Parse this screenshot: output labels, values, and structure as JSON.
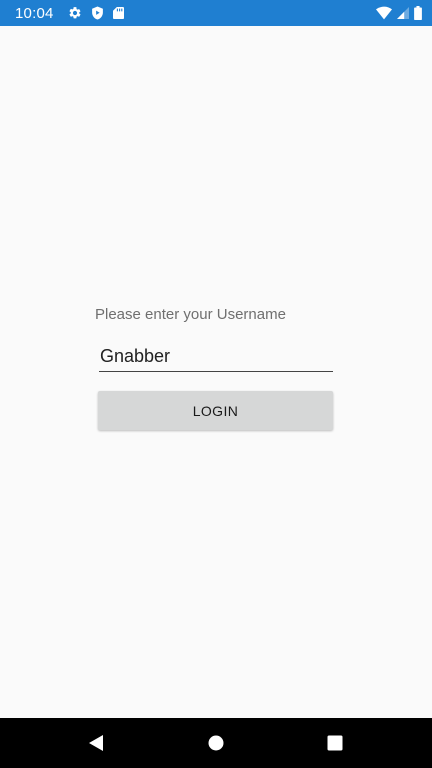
{
  "status_bar": {
    "time": "10:04",
    "left_icons": [
      "settings-icon",
      "play-protect-icon",
      "sd-card-icon"
    ],
    "right_icons": [
      "wifi-icon",
      "cell-signal-icon",
      "battery-icon"
    ],
    "background_color": "#1f7fd1"
  },
  "login_form": {
    "prompt": "Please enter your Username",
    "username_value": "Gnabber",
    "login_label": "LOGIN"
  },
  "nav_bar": {
    "icons": [
      "back-icon",
      "home-icon",
      "recents-icon"
    ]
  }
}
